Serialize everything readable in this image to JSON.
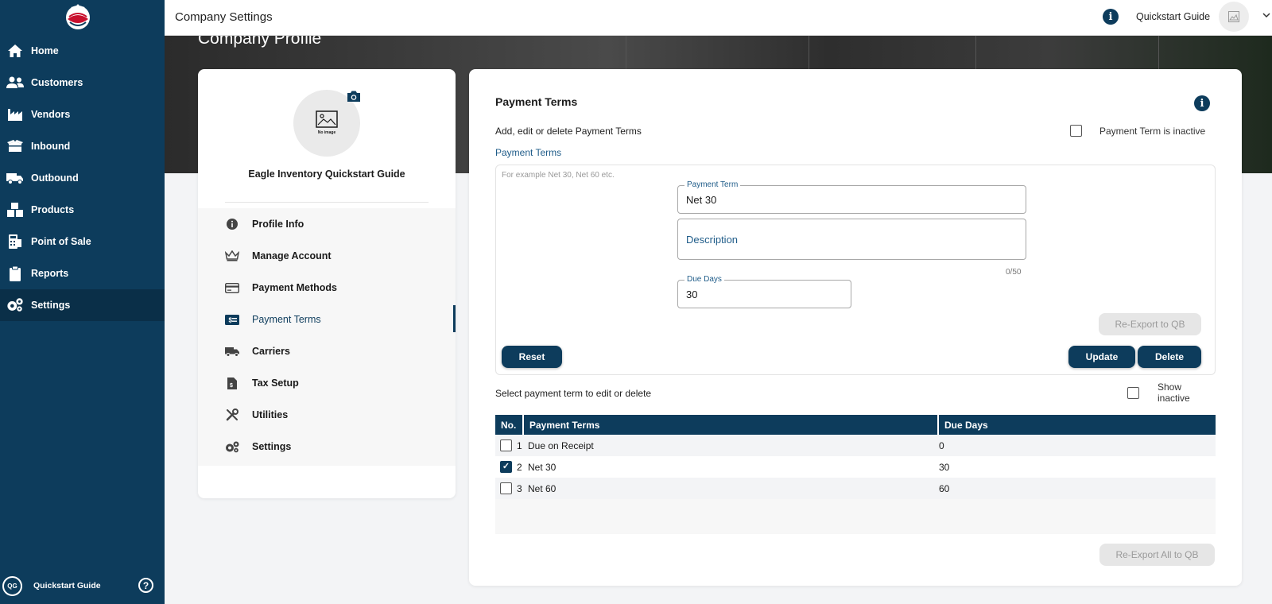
{
  "sidebar": {
    "items": [
      {
        "label": "Home",
        "icon": "home-icon"
      },
      {
        "label": "Customers",
        "icon": "customers-icon"
      },
      {
        "label": "Vendors",
        "icon": "vendors-icon"
      },
      {
        "label": "Inbound",
        "icon": "inbound-icon"
      },
      {
        "label": "Outbound",
        "icon": "outbound-icon"
      },
      {
        "label": "Products",
        "icon": "products-icon"
      },
      {
        "label": "Point of Sale",
        "icon": "pos-icon"
      },
      {
        "label": "Reports",
        "icon": "reports-icon"
      },
      {
        "label": "Settings",
        "icon": "settings-icon"
      }
    ],
    "active": "Settings",
    "user_initials": "QG",
    "user_name": "Quickstart Guide",
    "help": "?"
  },
  "topbar": {
    "title": "Company Settings",
    "guide_label": "Quickstart Guide",
    "info": "i"
  },
  "banner": {
    "title": "Company Profile"
  },
  "profile": {
    "avatar_text": "No image",
    "company_name": "Eagle Inventory Quickstart Guide",
    "menu": [
      {
        "label": "Profile Info",
        "icon": "info-icon"
      },
      {
        "label": "Manage Account",
        "icon": "crown-icon"
      },
      {
        "label": "Payment Methods",
        "icon": "credit-card-icon"
      },
      {
        "label": "Payment Terms",
        "icon": "payment-terms-icon"
      },
      {
        "label": "Carriers",
        "icon": "truck-icon"
      },
      {
        "label": "Tax Setup",
        "icon": "tax-icon"
      },
      {
        "label": "Utilities",
        "icon": "tools-icon"
      },
      {
        "label": "Settings",
        "icon": "gears-icon"
      }
    ],
    "active_menu": "Payment Terms"
  },
  "payment_terms": {
    "title": "Payment Terms",
    "subtitle": "Add, edit or delete Payment Terms",
    "inactive_label": "Payment Term is inactive",
    "inactive_checked": false,
    "section_link": "Payment Terms",
    "hint": "For example Net 30, Net 60 etc.",
    "term_legend": "Payment Term",
    "term_value": "Net 30",
    "description_placeholder": "Description",
    "description_counter": "0/50",
    "due_days_legend": "Due Days",
    "due_days_value": "30",
    "reexport_label": "Re-Export to QB",
    "reset_label": "Reset",
    "update_label": "Update",
    "delete_label": "Delete",
    "select_label": "Select payment term to edit or delete",
    "show_inactive_label": "Show inactive",
    "show_inactive_checked": false,
    "reexport_all_label": "Re-Export All to QB"
  },
  "table": {
    "headers": [
      "No.",
      "Payment Terms",
      "Due Days"
    ],
    "rows": [
      {
        "no": "1",
        "name": "Due on Receipt",
        "days": "0",
        "checked": false
      },
      {
        "no": "2",
        "name": "Net 30",
        "days": "30",
        "checked": true
      },
      {
        "no": "3",
        "name": "Net 60",
        "days": "60",
        "checked": false
      }
    ]
  },
  "colors": {
    "primary": "#0d3c5c",
    "link": "#1f5c89",
    "disabled_bg": "#e6e6e6"
  }
}
